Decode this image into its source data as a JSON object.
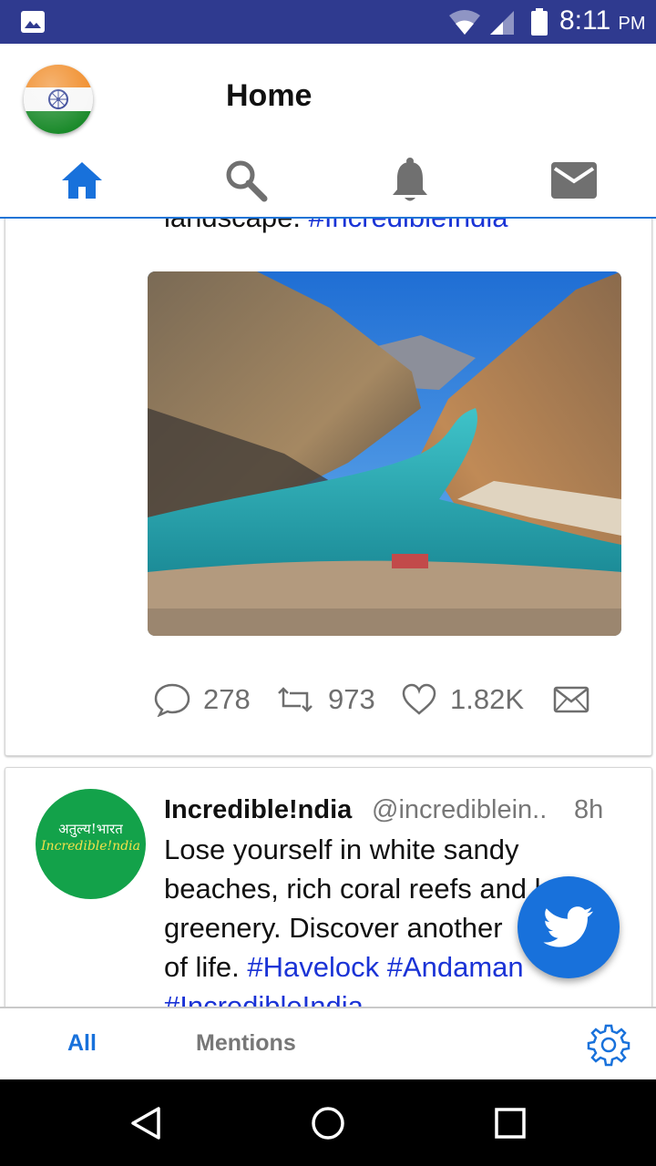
{
  "status_bar": {
    "time": "8:11",
    "ampm": "PM",
    "icons": [
      "gallery-icon",
      "wifi-icon",
      "signal-icon",
      "battery-icon"
    ]
  },
  "header": {
    "title": "Home",
    "tabs": [
      {
        "name": "home",
        "icon": "home-icon",
        "active": true
      },
      {
        "name": "search",
        "icon": "search-icon",
        "active": false
      },
      {
        "name": "notifications",
        "icon": "bell-icon",
        "active": false
      },
      {
        "name": "messages",
        "icon": "mail-icon",
        "active": false
      }
    ]
  },
  "feed": {
    "tweets": [
      {
        "text_visible": "landscape.",
        "hashtags": [
          "#IncredibleIndia"
        ],
        "image": "river-valley-photo",
        "actions": {
          "replies": "278",
          "retweets": "973",
          "likes": "1.82K"
        }
      },
      {
        "avatar_line1": "अतुल्य!भारत",
        "avatar_line2": "Incredible!ndia",
        "name": "Incredible!ndia",
        "handle": "@incrediblein..",
        "time": "8h",
        "text_line1": "Lose yourself in white sandy",
        "text_line2": "beaches, rich coral reefs and lush",
        "text_line3": "greenery. Discover another",
        "text_line4_prefix": "of life.",
        "hashtags": [
          "#Havelock",
          "#Andaman",
          "#IncredibleIndia"
        ]
      }
    ]
  },
  "bottom_bar": {
    "all_label": "All",
    "mentions_label": "Mentions"
  },
  "colors": {
    "status_bar": "#2f3a8f",
    "accent": "#1871db",
    "hashtag": "#1a33d6",
    "action_gray": "#6e6e6e"
  }
}
